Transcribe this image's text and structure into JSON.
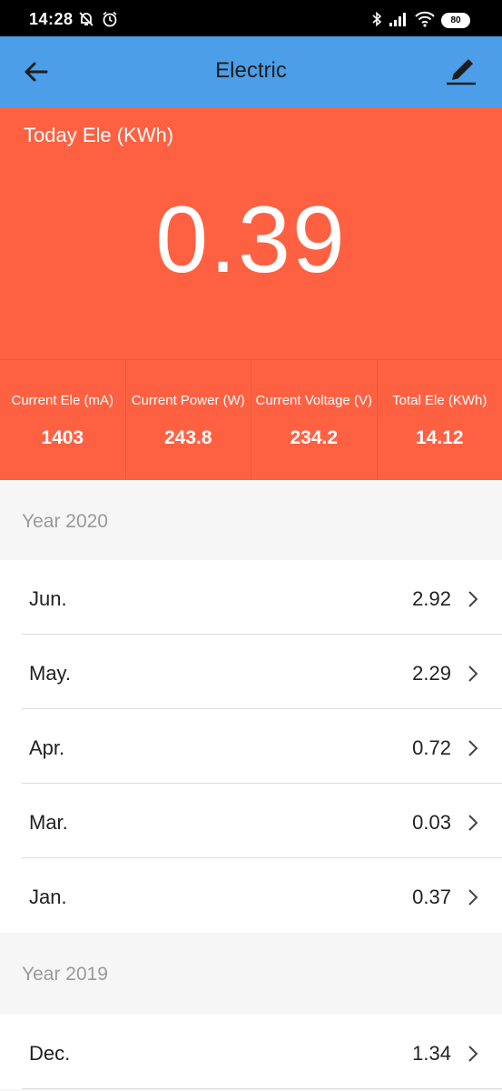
{
  "status_bar": {
    "time": "14:28",
    "battery": "80",
    "icons": [
      "bell-off-icon",
      "alarm-icon",
      "bluetooth-icon",
      "signal-icon",
      "wifi-icon",
      "battery-icon"
    ]
  },
  "app_bar": {
    "title": "Electric",
    "back_icon": "arrow-left-icon",
    "edit_icon": "pencil-edit-icon",
    "color": "#4c9ee8"
  },
  "today": {
    "label": "Today Ele (KWh)",
    "value": "0.39",
    "color": "#fe6142"
  },
  "stats": [
    {
      "label": "Current Ele (mA)",
      "value": "1403"
    },
    {
      "label": "Current Power (W)",
      "value": "243.8"
    },
    {
      "label": "Current Voltage (V)",
      "value": "234.2"
    },
    {
      "label": "Total Ele (KWh)",
      "value": "14.12"
    }
  ],
  "history": [
    {
      "year": "Year 2020",
      "months": [
        {
          "label": "Jun.",
          "value": "2.92"
        },
        {
          "label": "May.",
          "value": "2.29"
        },
        {
          "label": "Apr.",
          "value": "0.72"
        },
        {
          "label": "Mar.",
          "value": "0.03"
        },
        {
          "label": "Jan.",
          "value": "0.37"
        }
      ]
    },
    {
      "year": "Year 2019",
      "months": [
        {
          "label": "Dec.",
          "value": "1.34"
        }
      ]
    }
  ]
}
